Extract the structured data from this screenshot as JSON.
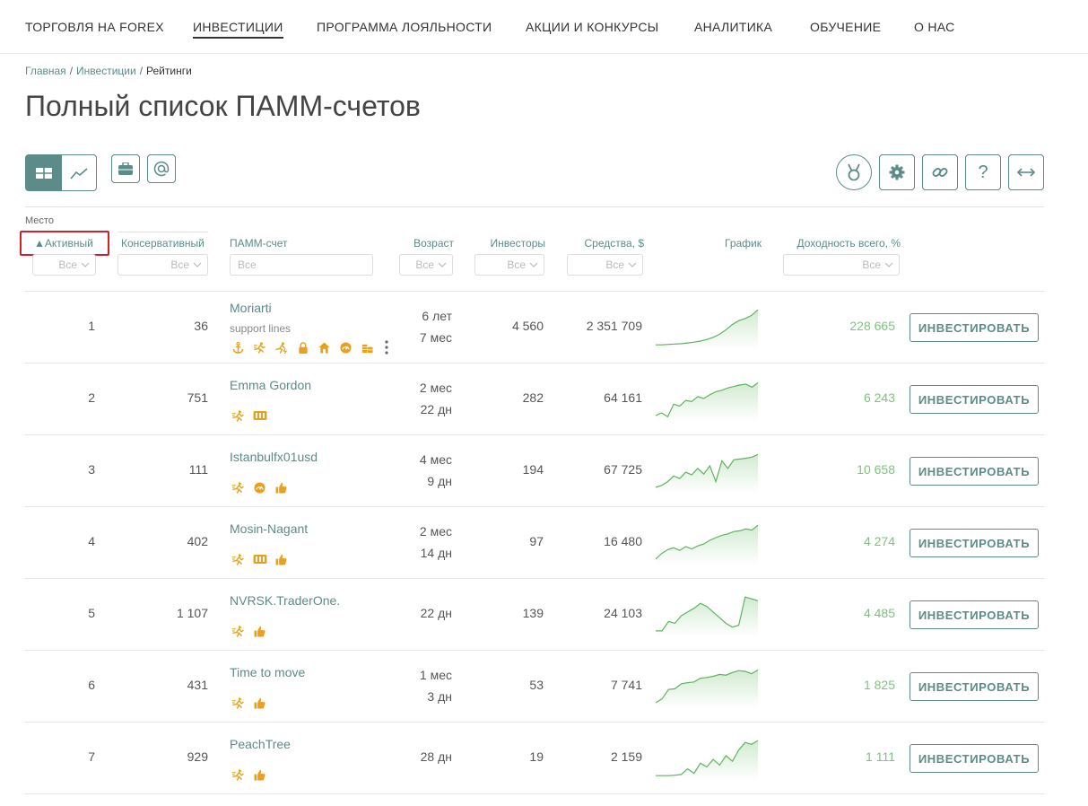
{
  "nav": {
    "items": [
      {
        "label": "ТОРГОВЛЯ НА FOREX",
        "active": false
      },
      {
        "label": "ИНВЕСТИЦИИ",
        "active": true
      },
      {
        "label": "ПРОГРАММА ЛОЯЛЬНОСТИ",
        "active": false
      },
      {
        "label": "АКЦИИ И КОНКУРСЫ",
        "active": false
      },
      {
        "label": "АНАЛИТИКА",
        "active": false
      },
      {
        "label": "ОБУЧЕНИЕ",
        "active": false
      },
      {
        "label": "О НАС",
        "active": false
      }
    ]
  },
  "breadcrumb": {
    "home": "Главная",
    "section": "Инвестиции",
    "current": "Рейтинги",
    "separator": "/"
  },
  "page_title": "Полный список ПАММ-счетов",
  "toolbar": {
    "left_icons": [
      "table-view-icon",
      "chart-view-icon",
      "briefcase-icon",
      "at-sign-icon"
    ],
    "right_icons": [
      "medal-icon",
      "gear-icon",
      "link-icon",
      "help-icon",
      "expand-width-icon"
    ],
    "help_glyph": "?"
  },
  "colors": {
    "accent": "#5b8c8a",
    "positive": "#7cc47c",
    "badge": "#e8a020",
    "highlight": "#d0202a"
  },
  "table": {
    "place_label": "Место",
    "columns": {
      "active": "▲Активный",
      "conservative": "Консервативный",
      "account": "ПАММ-счет",
      "age": "Возраст",
      "investors": "Инвесторы",
      "funds": "Средства, $",
      "chart": "График",
      "yield": "Доходность всего, %"
    },
    "filter_all": "Все",
    "invest_label": "ИНВЕСТИРОВАТЬ",
    "rows": [
      {
        "active": "1",
        "conservative": "36",
        "name": "Moriarti",
        "subtitle": "support lines",
        "age1": "6 лет",
        "age2": "7 мес",
        "investors": "4 560",
        "funds": "2 351 709",
        "yield": "228 665",
        "badges": [
          "anchor-icon",
          "runner-icon",
          "lightning-runner-icon",
          "lock-icon",
          "home-icon",
          "gauge-icon",
          "coins-icon"
        ],
        "has_menu": true,
        "spark": [
          0.02,
          0.02,
          0.03,
          0.04,
          0.05,
          0.07,
          0.09,
          0.12,
          0.16,
          0.22,
          0.3,
          0.42,
          0.56,
          0.66,
          0.72,
          0.8,
          0.95
        ]
      },
      {
        "active": "2",
        "conservative": "751",
        "name": "Emma Gordon",
        "subtitle": "",
        "age1": "2 мес",
        "age2": "22 дн",
        "investors": "282",
        "funds": "64 161",
        "yield": "6 243",
        "badges": [
          "runner-icon",
          "battery-icon"
        ],
        "has_menu": false,
        "spark": [
          0.05,
          0.12,
          0.02,
          0.35,
          0.3,
          0.45,
          0.42,
          0.55,
          0.5,
          0.6,
          0.68,
          0.72,
          0.78,
          0.82,
          0.86,
          0.88,
          0.8,
          0.92
        ]
      },
      {
        "active": "3",
        "conservative": "111",
        "name": "Istanbulfx01usd",
        "subtitle": "",
        "age1": "4 мес",
        "age2": "9 дн",
        "investors": "194",
        "funds": "67 725",
        "yield": "10 658",
        "badges": [
          "runner-icon",
          "gauge-icon",
          "thumbs-up-icon"
        ],
        "has_menu": false,
        "spark": [
          0.05,
          0.1,
          0.2,
          0.35,
          0.28,
          0.45,
          0.38,
          0.55,
          0.4,
          0.62,
          0.2,
          0.75,
          0.55,
          0.78,
          0.8,
          0.82,
          0.85,
          0.92
        ]
      },
      {
        "active": "4",
        "conservative": "402",
        "name": "Mosin-Nagant",
        "subtitle": "",
        "age1": "2 мес",
        "age2": "14 дн",
        "investors": "97",
        "funds": "16 480",
        "yield": "4 274",
        "badges": [
          "runner-icon",
          "battery-icon",
          "thumbs-up-icon"
        ],
        "has_menu": false,
        "spark": [
          0.05,
          0.2,
          0.3,
          0.35,
          0.28,
          0.38,
          0.32,
          0.4,
          0.45,
          0.55,
          0.62,
          0.68,
          0.72,
          0.78,
          0.8,
          0.85,
          0.82,
          0.95
        ]
      },
      {
        "active": "5",
        "conservative": "1 107",
        "name": "NVRSK.TraderOne.",
        "subtitle": "",
        "age1": "22 дн",
        "age2": "",
        "investors": "139",
        "funds": "24 103",
        "yield": "4 485",
        "badges": [
          "runner-icon",
          "thumbs-up-icon"
        ],
        "has_menu": false,
        "spark": [
          0.05,
          0.05,
          0.3,
          0.25,
          0.45,
          0.55,
          0.65,
          0.78,
          0.7,
          0.55,
          0.4,
          0.25,
          0.15,
          0.2,
          0.95,
          0.9,
          0.85
        ]
      },
      {
        "active": "6",
        "conservative": "431",
        "name": "Time to move",
        "subtitle": "",
        "age1": "1 мес",
        "age2": "3 дн",
        "investors": "53",
        "funds": "7 741",
        "yield": "1 825",
        "badges": [
          "runner-icon",
          "thumbs-up-icon"
        ],
        "has_menu": false,
        "spark": [
          0.05,
          0.15,
          0.4,
          0.42,
          0.55,
          0.58,
          0.6,
          0.7,
          0.72,
          0.75,
          0.8,
          0.78,
          0.85,
          0.9,
          0.88,
          0.82,
          0.92
        ]
      },
      {
        "active": "7",
        "conservative": "929",
        "name": "PeachTree",
        "subtitle": "",
        "age1": "28 дн",
        "age2": "",
        "investors": "19",
        "funds": "2 159",
        "yield": "1 111",
        "badges": [
          "runner-icon",
          "thumbs-up-icon"
        ],
        "has_menu": false,
        "spark": [
          0.02,
          0.02,
          0.02,
          0.03,
          0.05,
          0.2,
          0.08,
          0.35,
          0.25,
          0.45,
          0.3,
          0.55,
          0.4,
          0.7,
          0.9,
          0.85,
          0.95
        ]
      }
    ]
  }
}
